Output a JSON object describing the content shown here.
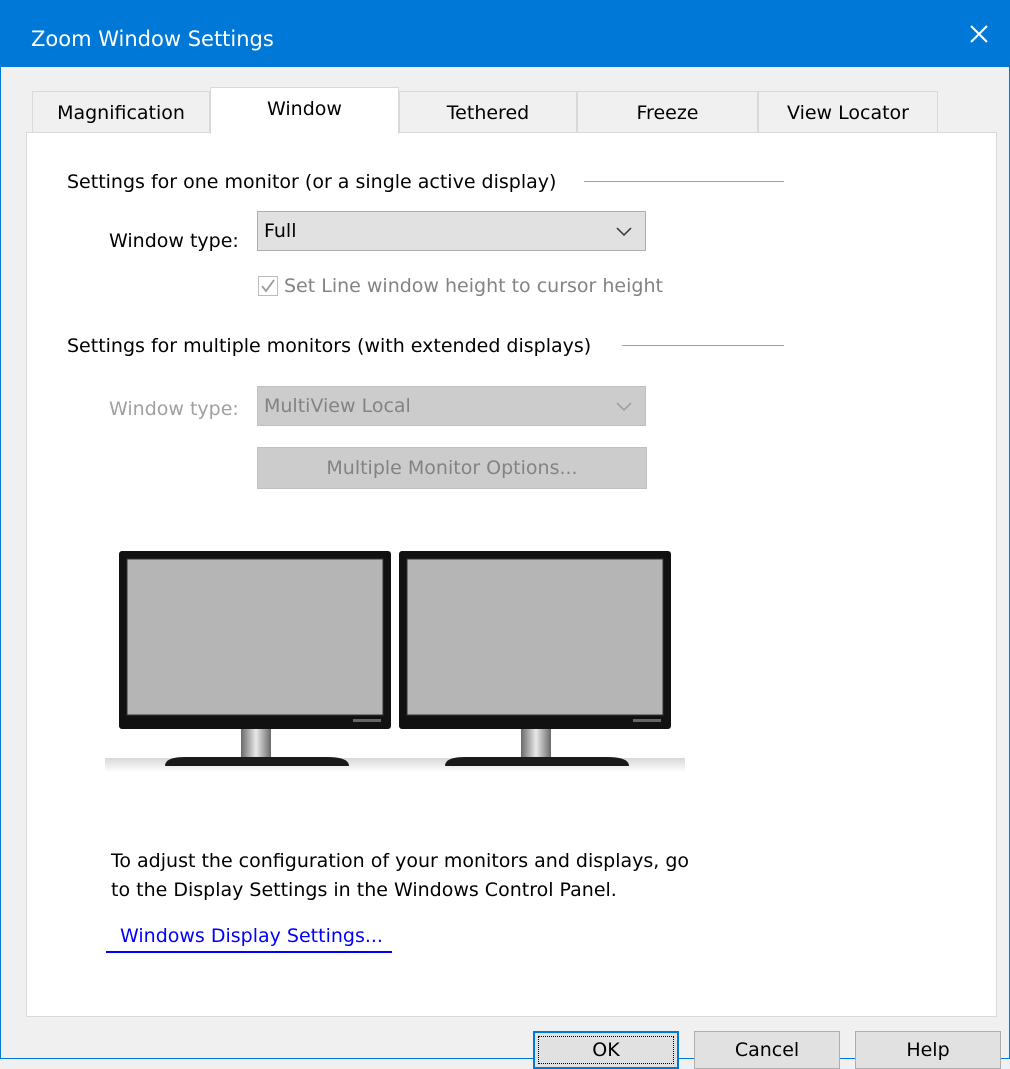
{
  "window": {
    "title": "Zoom Window Settings",
    "close_icon": "close-icon",
    "accent_color": "#0078d7"
  },
  "tabs": [
    {
      "label": "Magnification",
      "active": false
    },
    {
      "label": "Window",
      "active": true
    },
    {
      "label": "Tethered",
      "active": false
    },
    {
      "label": "Freeze",
      "active": false
    },
    {
      "label": "View Locator",
      "active": false
    }
  ],
  "single_monitor": {
    "heading": "Settings for one monitor (or a single active display)",
    "window_type_label": "Window type:",
    "window_type_value": "Full",
    "checkbox_label": "Set Line window height to cursor height",
    "checkbox_checked": true,
    "checkbox_enabled": false
  },
  "multi_monitor": {
    "heading": "Settings for multiple monitors (with extended displays)",
    "window_type_label": "Window type:",
    "window_type_value": "MultiView Local",
    "window_type_enabled": false,
    "options_button": "Multiple Monitor Options...",
    "options_enabled": false
  },
  "monitors_image": {
    "icon": "dual-monitor-illustration",
    "count": 2
  },
  "info": {
    "line1": "To adjust the configuration of your monitors and displays, go",
    "line2": "to the Display Settings in the Windows Control Panel.",
    "link": "Windows Display Settings..."
  },
  "footer": {
    "ok": "OK",
    "cancel": "Cancel",
    "help": "Help"
  }
}
